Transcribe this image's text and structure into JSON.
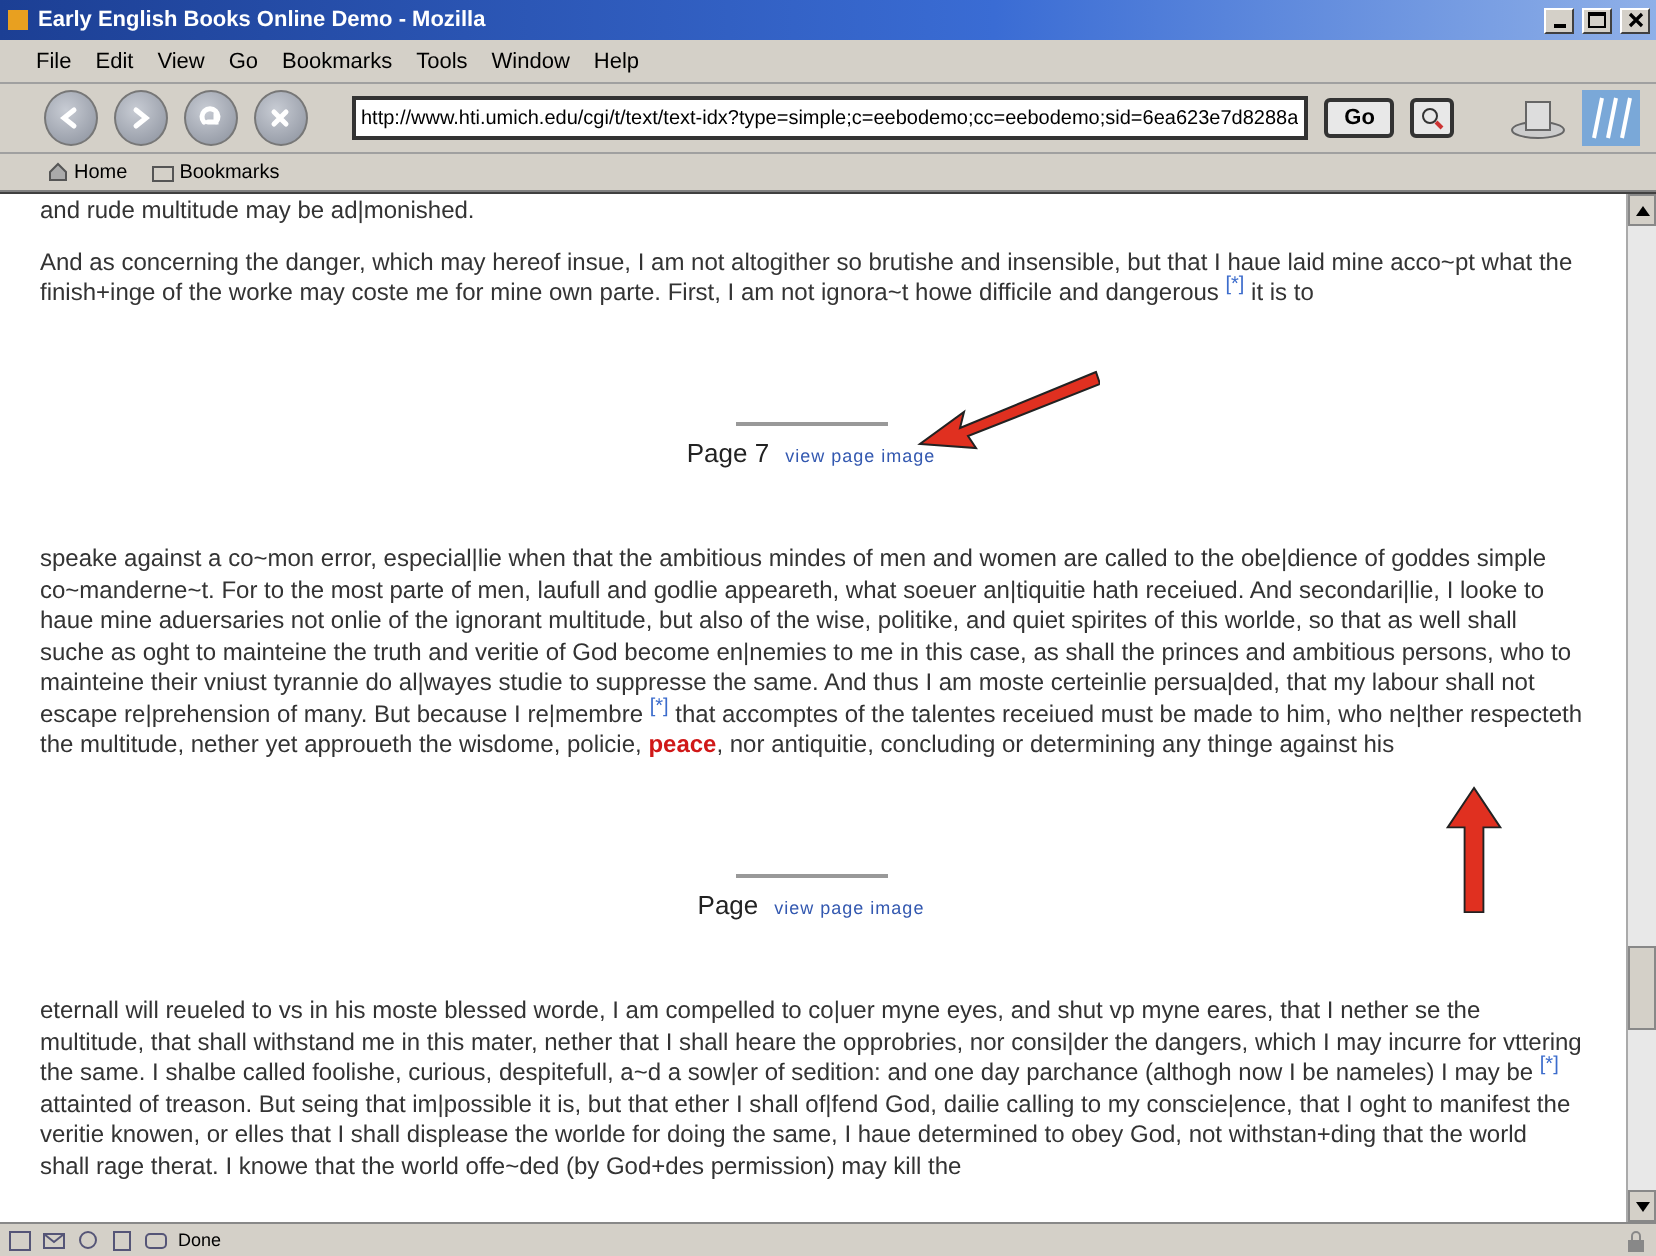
{
  "window": {
    "title": "Early English Books Online Demo - Mozilla"
  },
  "menu": [
    "File",
    "Edit",
    "View",
    "Go",
    "Bookmarks",
    "Tools",
    "Window",
    "Help"
  ],
  "navigation": {
    "url": "http://www.hti.umich.edu/cgi/t/text/text-idx?type=simple;c=eebodemo;cc=eebodemo;sid=6ea623e7d8288a",
    "go_label": "Go"
  },
  "personal_bar": [
    {
      "label": "Home",
      "kind": "home"
    },
    {
      "label": "Bookmarks",
      "kind": "folder"
    }
  ],
  "content": [
    {
      "kind": "paragraph",
      "segments": [
        {
          "kind": "text",
          "text": "and rude multitude may be ad|monished."
        }
      ]
    },
    {
      "kind": "paragraph",
      "segments": [
        {
          "kind": "text",
          "text": "And as concerning the danger, which may hereof insue, I am not altogither so brutishe and insensible, but that I haue laid mine acco~pt what the finish+inge of the worke may coste me for mine own parte. First, I am not ignora~t howe difficile and dangerous "
        },
        {
          "kind": "note",
          "text": "[*]"
        },
        {
          "kind": "text",
          "text": " it is to"
        }
      ]
    },
    {
      "kind": "page_break",
      "label": "Page 7",
      "link": "view page image"
    },
    {
      "kind": "paragraph",
      "segments": [
        {
          "kind": "text",
          "text": "speake against a co~mon error, especial|lie when that the ambitious mindes of men and women are called to the obe|dience of goddes simple co~manderne~t. For to the most parte of men, laufull and godlie appeareth, what soeuer an|tiquitie hath receiued. And secondari|lie, I looke to haue mine aduersaries not onlie of the ignorant multitude, but also of the wise, politike, and quiet spirites of this worlde, so that as well shall suche as oght to mainteine the truth and veritie of God become en|nemies to me in this case, as shall the princes and ambitious persons, who to mainteine their vniust tyrannie do al|wayes studie to suppresse the same. And thus I am moste certeinlie persua|ded, that my labour shall not escape re|prehension of many. But because I re|membre "
        },
        {
          "kind": "note",
          "text": "[*]"
        },
        {
          "kind": "text",
          "text": " that accomptes of the talentes receiued must be made to him, who ne|ther respecteth the multitude, nether yet approueth the wisdome, policie, "
        },
        {
          "kind": "hit",
          "text": "peace"
        },
        {
          "kind": "text",
          "text": ", nor antiquitie, concluding or determining any thinge against his"
        }
      ]
    },
    {
      "kind": "page_break",
      "label": "Page",
      "link": "view page image"
    },
    {
      "kind": "paragraph",
      "segments": [
        {
          "kind": "text",
          "text": "eternall will reueled to vs in his moste blessed worde, I am compelled to co|uer myne eyes, and shut vp myne eares, that I nether se the multitude, that shall withstand me in this mater, nether that I shall heare the opprobries, nor consi|der the dangers, which I may incurre for vttering the same. I shalbe called foolishe, curious, despitefull, a~d a sow|er of sedition: and one day parchance (althogh now I be nameles) I may be "
        },
        {
          "kind": "note",
          "text": "[*]"
        },
        {
          "kind": "text",
          "text": " attainted of treason. But seing that im|possible it is, but that ether I shall of|fend God, dailie calling to my conscie|ence, that I oght to manifest the veritie knowen, or elles that I shall displease the worlde for doing the same, I haue determined to obey God, not withstan+ding that the world shall rage therat. I knowe that the world offe~ded (by God+des permission) may kill the"
        }
      ]
    }
  ],
  "status": {
    "text": "Done"
  }
}
